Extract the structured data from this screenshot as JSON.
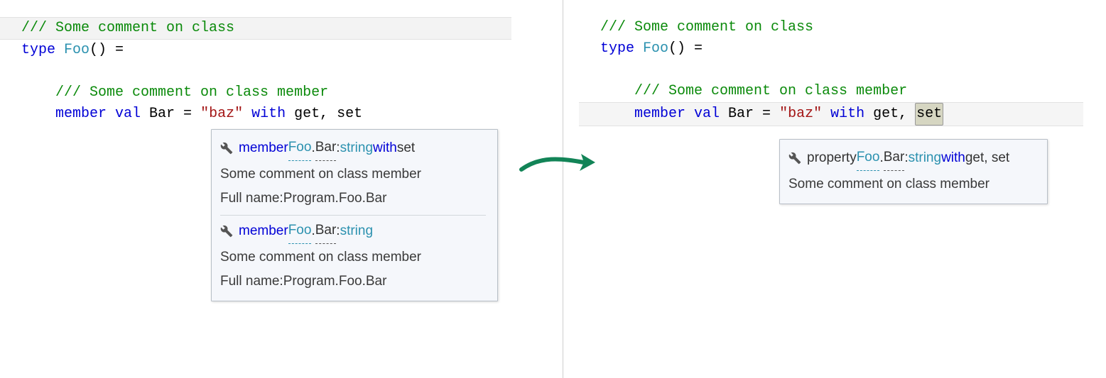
{
  "code_left": {
    "l1_cmt": "/// Some comment on class",
    "l2_kw_type": "type ",
    "l2_typename": "Foo",
    "l2_rest": "() =",
    "l4_cmt": "    /// Some comment on class member",
    "l5_kw_member": "    member ",
    "l5_kw_val": "val ",
    "l5_name": "Bar = ",
    "l5_str": "\"baz\"",
    "l5_kw_with": " with ",
    "l5_rest": "get, set"
  },
  "code_right": {
    "l1_cmt": "/// Some comment on class",
    "l2_kw_type": "type ",
    "l2_typename": "Foo",
    "l2_rest": "() =",
    "l4_cmt": "    /// Some comment on class member",
    "l5_kw_member": "    member ",
    "l5_kw_val": "val ",
    "l5_name": "Bar = ",
    "l5_str": "\"baz\"",
    "l5_kw_with": " with ",
    "l5_get": "get, ",
    "l5_set": "set"
  },
  "tooltip_left": {
    "entry1": {
      "sig_kw": "member ",
      "sig_type": "Foo",
      "sig_dot": ".",
      "sig_member": "Bar",
      "sig_colon": ": ",
      "sig_ret": "string",
      "sig_with": " with ",
      "sig_acc": "set",
      "desc": "Some comment on class member",
      "fullname_label": "Full name: ",
      "fullname": "Program.Foo.Bar"
    },
    "entry2": {
      "sig_kw": "member ",
      "sig_type": "Foo",
      "sig_dot": ".",
      "sig_member": "Bar",
      "sig_colon": ": ",
      "sig_ret": "string",
      "desc": "Some comment on class member",
      "fullname_label": "Full name: ",
      "fullname": "Program.Foo.Bar"
    }
  },
  "tooltip_right": {
    "sig_kw": "property ",
    "sig_type": "Foo",
    "sig_dot": ".",
    "sig_member": "Bar",
    "sig_colon": ": ",
    "sig_ret": "string",
    "sig_with": " with ",
    "sig_acc": "get, set",
    "desc": "Some comment on class member"
  }
}
